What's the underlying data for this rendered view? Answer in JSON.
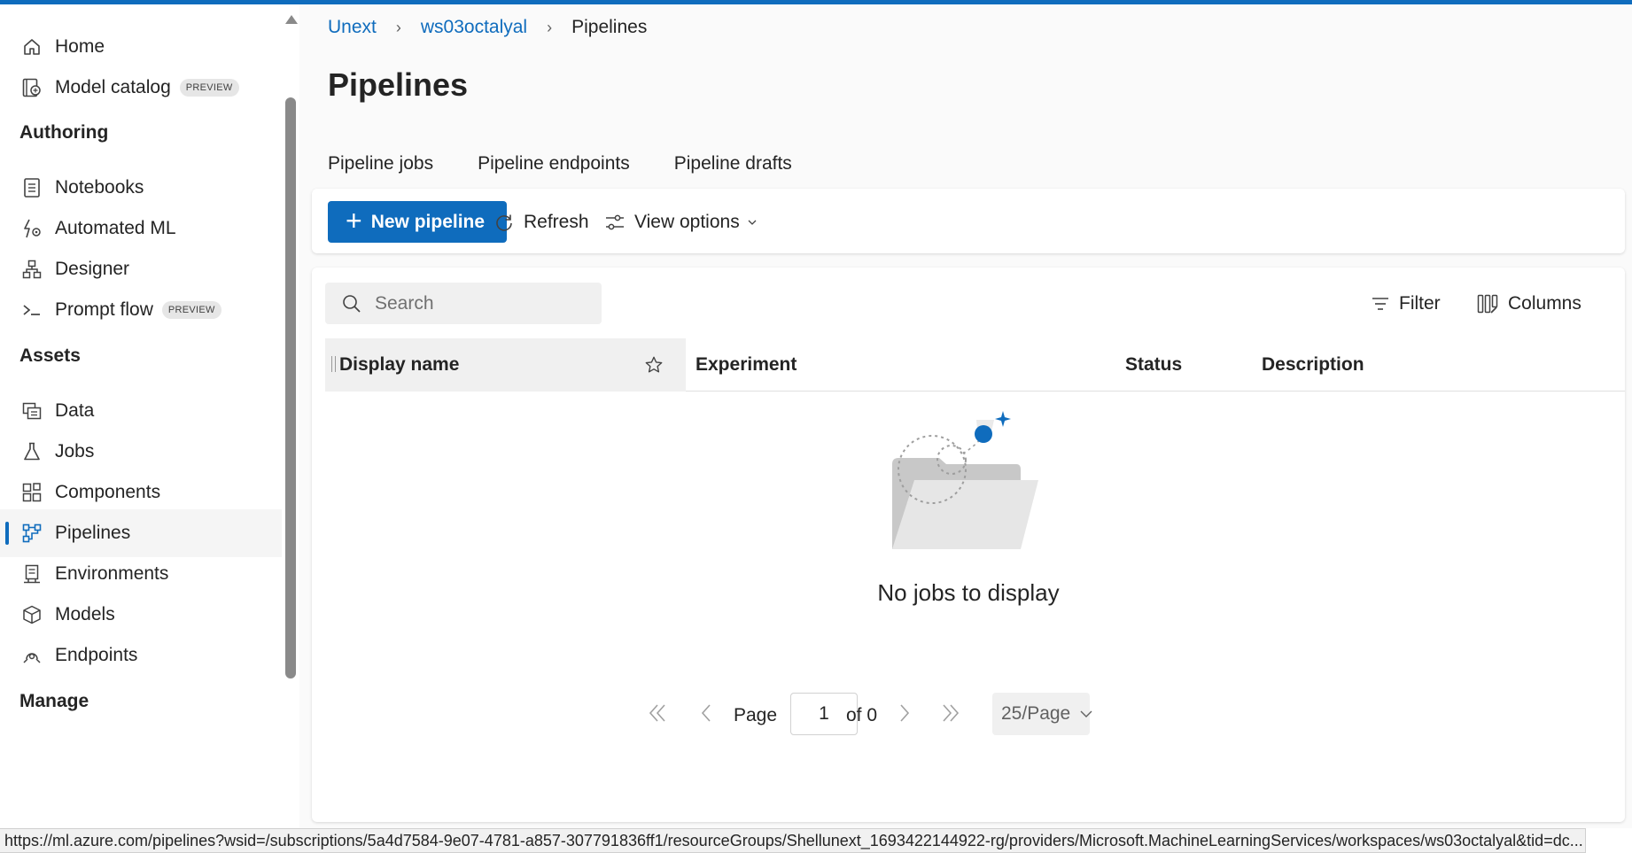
{
  "sidebar": {
    "items_top": [
      {
        "label": "Home",
        "icon": "home-icon"
      },
      {
        "label": "Model catalog",
        "icon": "model-catalog-icon",
        "badge": "PREVIEW"
      }
    ],
    "authoring": {
      "title": "Authoring",
      "items": [
        {
          "label": "Notebooks",
          "icon": "notebook-icon"
        },
        {
          "label": "Automated ML",
          "icon": "automated-ml-icon"
        },
        {
          "label": "Designer",
          "icon": "designer-icon"
        },
        {
          "label": "Prompt flow",
          "icon": "prompt-flow-icon",
          "badge": "PREVIEW"
        }
      ]
    },
    "assets": {
      "title": "Assets",
      "items": [
        {
          "label": "Data",
          "icon": "data-icon"
        },
        {
          "label": "Jobs",
          "icon": "jobs-flask-icon"
        },
        {
          "label": "Components",
          "icon": "components-icon"
        },
        {
          "label": "Pipelines",
          "icon": "pipelines-icon",
          "active": true
        },
        {
          "label": "Environments",
          "icon": "environments-icon"
        },
        {
          "label": "Models",
          "icon": "models-cube-icon"
        },
        {
          "label": "Endpoints",
          "icon": "endpoints-icon"
        }
      ]
    },
    "manage": {
      "title": "Manage"
    }
  },
  "breadcrumb": {
    "items": [
      "Unext",
      "ws03octalyal"
    ],
    "current": "Pipelines"
  },
  "page": {
    "title": "Pipelines"
  },
  "tabs": [
    {
      "label": "Pipeline jobs",
      "selected": true
    },
    {
      "label": "Pipeline endpoints"
    },
    {
      "label": "Pipeline drafts"
    }
  ],
  "toolbar": {
    "new_pipeline": "New pipeline",
    "refresh": "Refresh",
    "view_options": "View options"
  },
  "list": {
    "search_placeholder": "Search",
    "filter": "Filter",
    "columns": "Columns",
    "headers": {
      "display_name": "Display name",
      "experiment": "Experiment",
      "status": "Status",
      "description": "Description"
    },
    "empty_message": "No jobs to display"
  },
  "pager": {
    "page_label": "Page",
    "page_value": "1",
    "of_label": "of 0",
    "page_size": "25/Page"
  },
  "statusbar": {
    "url": "https://ml.azure.com/pipelines?wsid=/subscriptions/5a4d7584-9e07-4781-a857-307791836ff1/resourceGroups/Shellunext_1693422144922-rg/providers/Microsoft.MachineLearningServices/workspaces/ws03octalyal&tid=dc..."
  },
  "colors": {
    "accent": "#0f6cbd",
    "sidebar_active_bg": "#f5f5f5",
    "main_bg": "#fafafa"
  }
}
